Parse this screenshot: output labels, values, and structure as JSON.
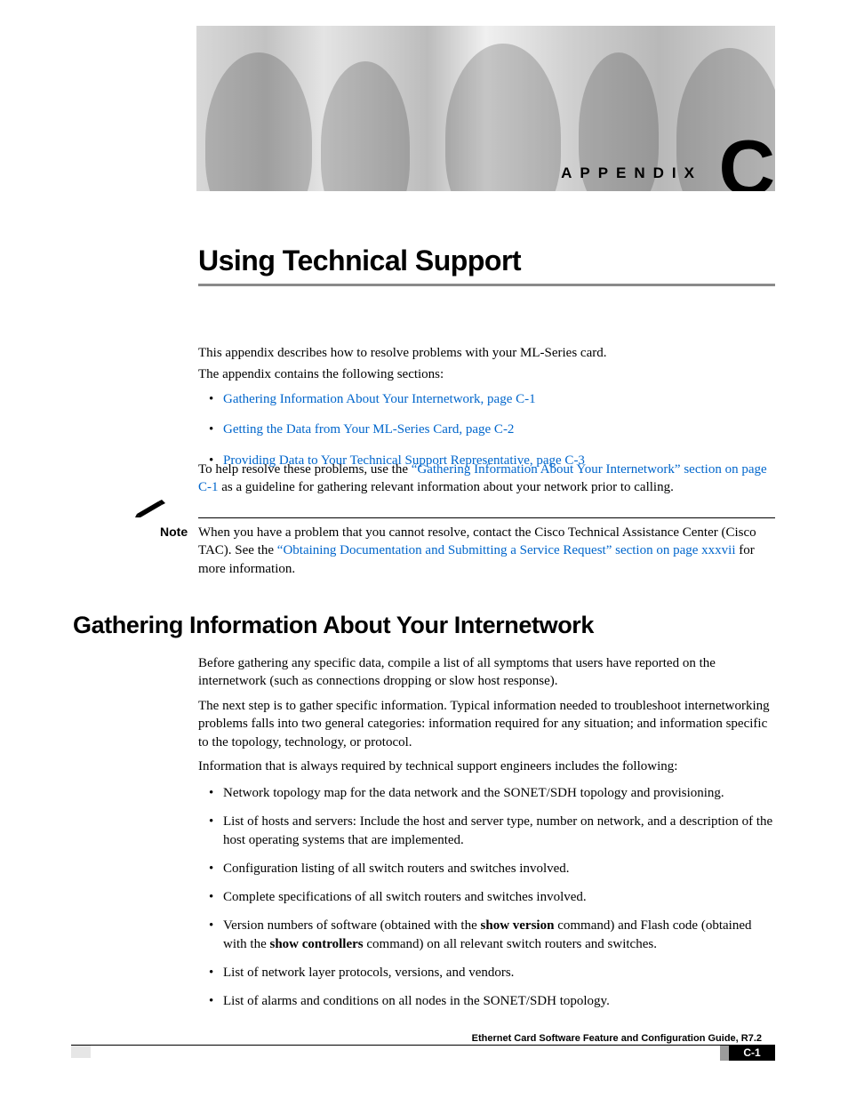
{
  "banner": {
    "label": "APPENDIX",
    "letter": "C"
  },
  "chapter_title": "Using Technical Support",
  "intro": {
    "p1": "This appendix describes how to resolve problems with your ML-Series card.",
    "p2": "The appendix contains the following sections:"
  },
  "toc": [
    "Gathering Information About Your Internetwork, page C-1",
    "Getting the Data from Your ML-Series Card, page C-2",
    "Providing Data to Your Technical Support Representative, page C-3"
  ],
  "resolve": {
    "lead": "To help resolve these problems, use the ",
    "link": "“Gathering Information About Your Internetwork” section on page C-1",
    "tail": " as a guideline for gathering relevant information about your network prior to calling."
  },
  "note": {
    "label": "Note",
    "lead": "When you have a problem that you cannot resolve, contact the Cisco Technical Assistance Center (Cisco TAC). See the ",
    "link": "“Obtaining Documentation and Submitting a Service Request” section on page xxxvii",
    "tail": " for more information."
  },
  "section_h1": "Gathering Information About Your Internetwork",
  "para": {
    "a": "Before gathering any specific data, compile a list of all symptoms that users have reported on the internetwork (such as connections dropping or slow host response).",
    "b": "The next step is to gather specific information. Typical information needed to troubleshoot internetworking problems falls into two general categories: information required for any situation; and information specific to the topology, technology, or protocol.",
    "c": "Information that is always required by technical support engineers includes the following:"
  },
  "info_list": {
    "i1": "Network topology map for the data network and the SONET/SDH topology and provisioning.",
    "i2": "List of hosts and servers: Include the host and server type, number on network, and a description of the host operating systems that are implemented.",
    "i3": "Configuration listing of all switch routers and switches involved.",
    "i4": "Complete specifications of all switch routers and switches involved.",
    "i5_pre": "Version numbers of software (obtained with the ",
    "i5_b1": "show version",
    "i5_mid": " command) and Flash code (obtained with the ",
    "i5_b2": "show controllers",
    "i5_post": " command) on all relevant switch routers and switches.",
    "i6": "List of network layer protocols, versions, and vendors.",
    "i7": "List of alarms and conditions on all nodes in the SONET/SDH topology."
  },
  "footer": {
    "title": "Ethernet Card Software Feature and Configuration Guide, R7.2",
    "page": "C-1"
  }
}
